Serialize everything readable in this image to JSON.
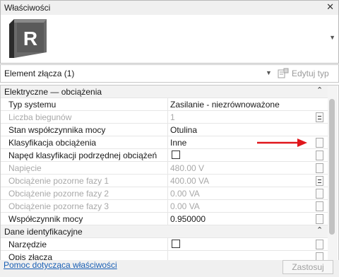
{
  "window": {
    "title": "Właściwości",
    "close_glyph": "✕"
  },
  "type_selector": {
    "logo_letter": "R",
    "dropdown_glyph": "▼"
  },
  "element": {
    "label": "Element złącza (1)",
    "dropdown_glyph": "▼",
    "edit_type_label": "Edytuj typ"
  },
  "groups": [
    {
      "title": "Elektryczne — obciążenia",
      "collapse_glyph": "⌃",
      "rows": [
        {
          "name": "Typ systemu",
          "value": "Zasilanie - niezrównoważone",
          "disabled": false,
          "control": "none"
        },
        {
          "name": "Liczba biegunów",
          "value": "1",
          "disabled": true,
          "control": "equals"
        },
        {
          "name": "Stan współczynnika mocy",
          "value": "Otulina",
          "disabled": false,
          "control": "none"
        },
        {
          "name": "Klasyfikacja obciążenia",
          "value": "Inne",
          "disabled": false,
          "control": "box"
        },
        {
          "name": "Napęd klasyfikacji podrzędnej obciążeń",
          "value": "",
          "checkbox": false,
          "disabled": false,
          "control": "box"
        },
        {
          "name": "Napięcie",
          "value": "480.00 V",
          "disabled": true,
          "control": "box"
        },
        {
          "name": "Obciążenie pozorne fazy 1",
          "value": "400.00 VA",
          "disabled": true,
          "control": "equals"
        },
        {
          "name": "Obciążenie pozorne fazy 2",
          "value": "0.00 VA",
          "disabled": true,
          "control": "box"
        },
        {
          "name": "Obciążenie pozorne fazy 3",
          "value": "0.00 VA",
          "disabled": true,
          "control": "box"
        },
        {
          "name": "Współczynnik mocy",
          "value": "0.950000",
          "disabled": false,
          "control": "box"
        }
      ]
    },
    {
      "title": "Dane identyfikacyjne",
      "collapse_glyph": "⌃",
      "rows": [
        {
          "name": "Narzędzie",
          "value": "",
          "checkbox": false,
          "disabled": false,
          "control": "box"
        },
        {
          "name": "Opis złącza",
          "value": "",
          "disabled": false,
          "control": "box"
        }
      ]
    }
  ],
  "footer": {
    "help_link": "Pomoc dotycząca właściwości",
    "apply_label": "Zastosuj"
  },
  "colors": {
    "arrow": "#e0161b",
    "link": "#1a5fb4",
    "logo_bg": "#4a4a4a"
  }
}
